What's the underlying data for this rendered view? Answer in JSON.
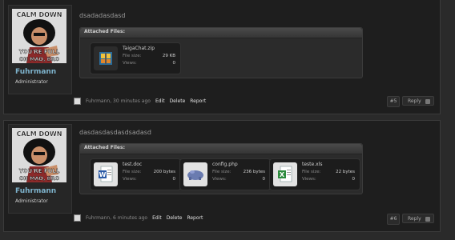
{
  "posts": [
    {
      "author": {
        "name": "Fuhrmann",
        "title": "Administrator",
        "avatar_caption": [
          "CALM DOWN",
          "YOU'RE FULL",
          "ON MAD, BRO"
        ]
      },
      "text": "dsadadasdasd",
      "attachments_header": "Attached Files:",
      "attachments": [
        {
          "name": "TaigaChat.zip",
          "size_label": "File size:",
          "size": "29 KB",
          "views_label": "Views:",
          "views": "0",
          "icon": "zip-archive-icon"
        }
      ],
      "footer": {
        "meta": "Fuhrmann, 30 minutes ago",
        "edit": "Edit",
        "delete": "Delete",
        "report": "Report"
      },
      "number": "#5",
      "reply": "Reply"
    },
    {
      "author": {
        "name": "Fuhrmann",
        "title": "Administrator",
        "avatar_caption": [
          "CALM DOWN",
          "YOU'RE FULL",
          "ON MAD, BRO"
        ]
      },
      "text": "dasdasdasdasdsadasd",
      "attachments_header": "Attached Files:",
      "attachments": [
        {
          "name": "test.doc",
          "size_label": "File size:",
          "size": "200 bytes",
          "views_label": "Views:",
          "views": "0",
          "icon": "word-document-icon"
        },
        {
          "name": "config.php",
          "size_label": "File size:",
          "size": "236 bytes",
          "views_label": "Views:",
          "views": "0",
          "icon": "php-file-icon"
        },
        {
          "name": "teste.xls",
          "size_label": "File size:",
          "size": "22 bytes",
          "views_label": "Views:",
          "views": "0",
          "icon": "excel-spreadsheet-icon"
        }
      ],
      "footer": {
        "meta": "Fuhrmann, 6 minutes ago",
        "edit": "Edit",
        "delete": "Delete",
        "report": "Report"
      },
      "number": "#6",
      "reply": "Reply"
    }
  ],
  "colors": {
    "username": "#7eb3cc",
    "background": "#1e1e1e"
  }
}
